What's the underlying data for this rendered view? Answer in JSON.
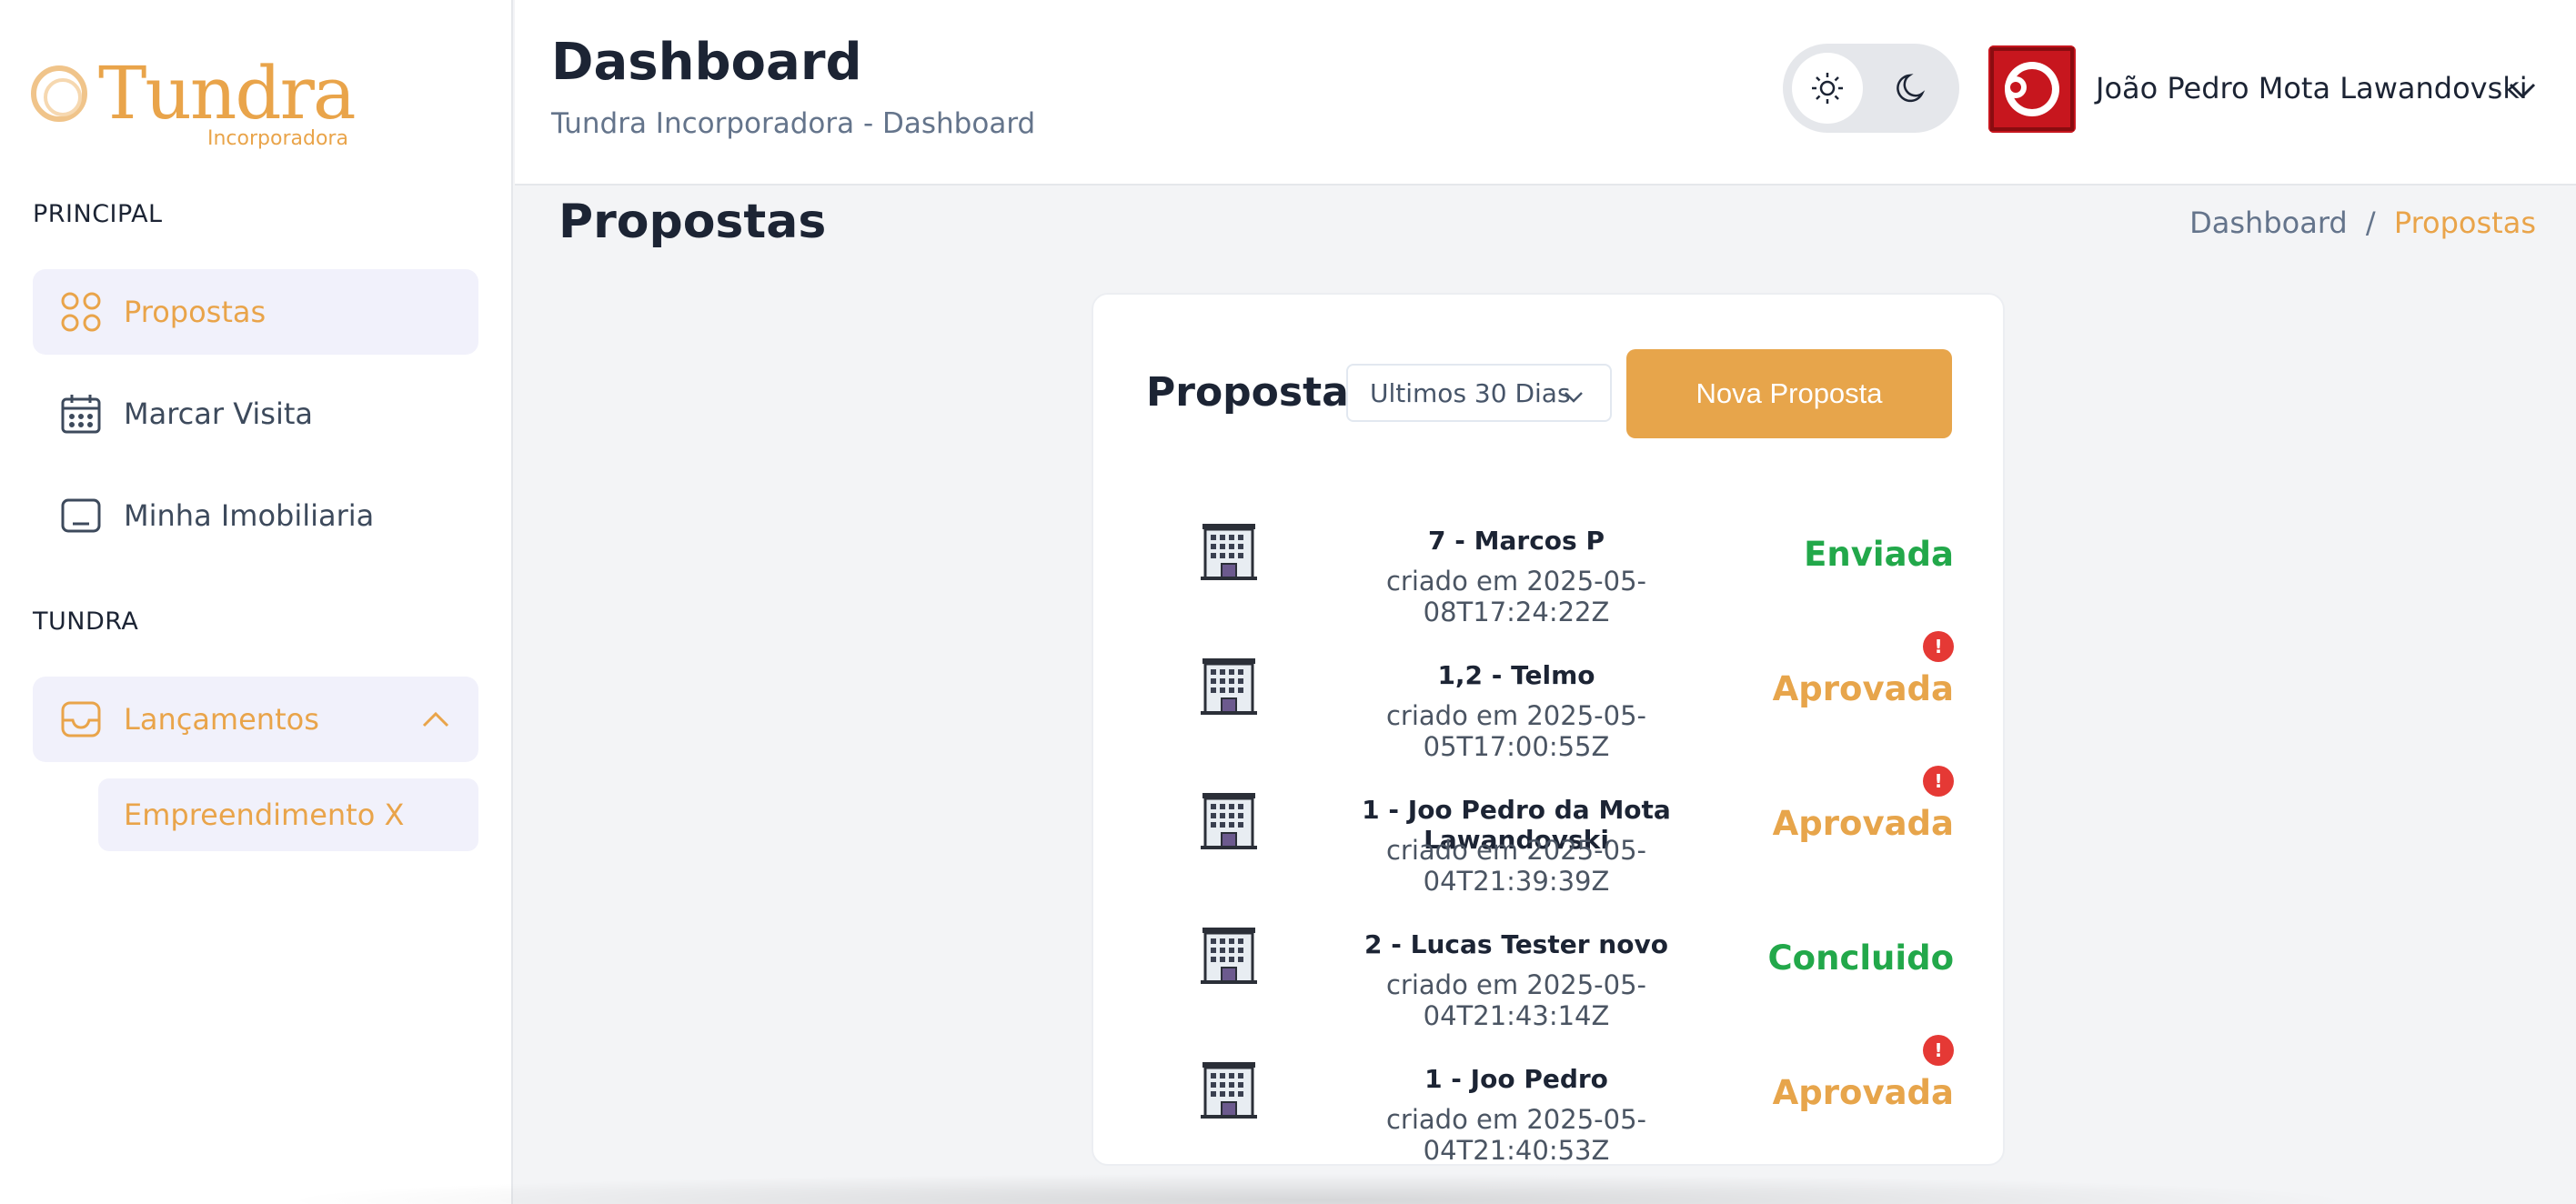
{
  "brand": {
    "logo_text": "Tundra",
    "logo_sub": "Incorporadora",
    "accent": "#e9a44a"
  },
  "sidebar": {
    "sections": [
      {
        "title": "PRINCIPAL"
      },
      {
        "title": "TUNDRA"
      }
    ],
    "items": [
      {
        "label": "Propostas",
        "icon": "grid-icon",
        "active": true
      },
      {
        "label": "Marcar Visita",
        "icon": "calendar-icon",
        "active": false
      },
      {
        "label": "Minha Imobiliaria",
        "icon": "card-icon",
        "active": false
      },
      {
        "label": "Lançamentos",
        "icon": "inbox-icon",
        "active": true,
        "expanded": true
      }
    ],
    "sub_items": [
      {
        "label": "Empreendimento X"
      }
    ]
  },
  "header": {
    "title": "Dashboard",
    "subtitle": "Tundra Incorporadora - Dashboard",
    "theme_toggle": {
      "light_icon": "sun-icon",
      "dark_icon": "moon-icon",
      "selected": "light"
    },
    "user": {
      "name": "João Pedro Mota Lawandovski"
    }
  },
  "page": {
    "title": "Propostas",
    "breadcrumb": {
      "parent": "Dashboard",
      "separator": "/",
      "current": "Propostas"
    }
  },
  "card": {
    "title": "Propostas",
    "period_select": "Ultimos 30 Dias",
    "new_button": "Nova Proposta",
    "rows": [
      {
        "name": "7 - Marcos P",
        "date": "criado em 2025-05-08T17:24:22Z",
        "status": "Enviada",
        "status_color": "#22a84a",
        "alert": false
      },
      {
        "name": "1,2 - Telmo",
        "date": "criado em 2025-05-05T17:00:55Z",
        "status": "Aprovada",
        "status_color": "#e7a54b",
        "alert": true
      },
      {
        "name": "1 - Joo Pedro da Mota Lawandovski",
        "date": "criado em 2025-05-04T21:39:39Z",
        "status": "Aprovada",
        "status_color": "#e7a54b",
        "alert": true
      },
      {
        "name": "2 - Lucas Tester novo",
        "date": "criado em 2025-05-04T21:43:14Z",
        "status": "Concluido",
        "status_color": "#22a84a",
        "alert": false
      },
      {
        "name": "1 - Joo Pedro",
        "date": "criado em 2025-05-04T21:40:53Z",
        "status": "Aprovada",
        "status_color": "#e7a54b",
        "alert": true
      }
    ],
    "alert_glyph": "!"
  }
}
